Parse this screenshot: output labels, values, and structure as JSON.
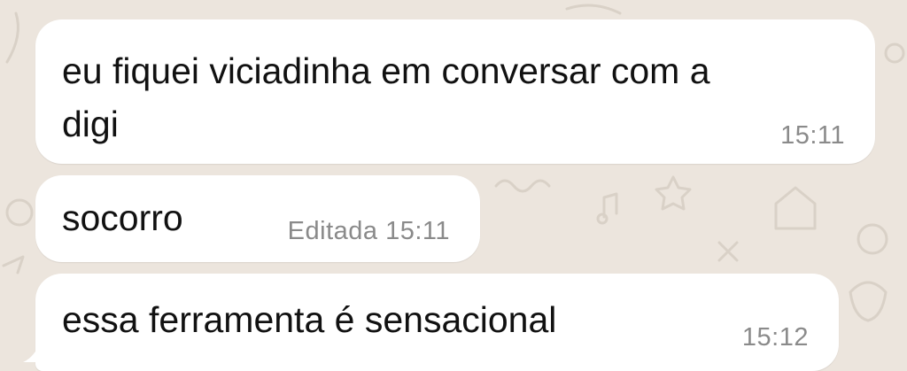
{
  "chat": {
    "background_color": "#ece5dd",
    "bubble_color": "#ffffff",
    "messages": [
      {
        "text_line1": "eu fiquei viciadinha em conversar com a",
        "text_line2": "digi",
        "time": "15:11"
      },
      {
        "text": "socorro",
        "meta": "Editada 15:11"
      },
      {
        "text": "essa ferramenta é sensacional",
        "time": "15:12"
      }
    ]
  }
}
